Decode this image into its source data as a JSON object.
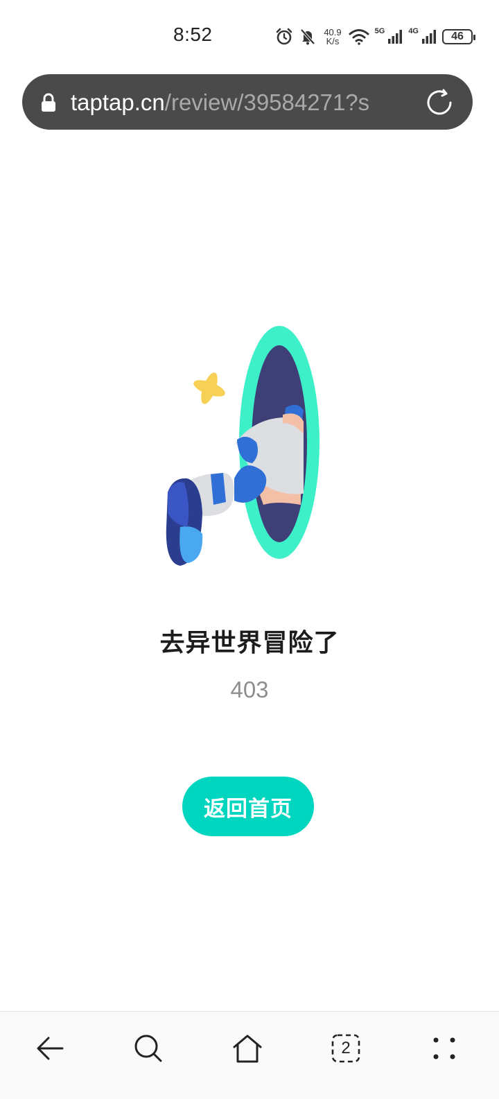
{
  "status_bar": {
    "time": "8:52",
    "net_speed_value": "40.9",
    "net_speed_unit": "K/s",
    "sim1_type": "5G",
    "sim2_type": "4G",
    "battery": "46"
  },
  "address_bar": {
    "domain": "taptap.cn",
    "path": "/review/39584271?s"
  },
  "error_page": {
    "title": "去异世界冒险了",
    "code": "403",
    "home_button_label": "返回首页"
  },
  "bottom_nav": {
    "tab_count": "2",
    "items": [
      "back-icon",
      "search-icon",
      "home-icon",
      "tabs-icon",
      "menu-icon"
    ]
  },
  "colors": {
    "accent": "#00d6bf",
    "portal_ring": "#3ef0c8",
    "portal_inner": "#3f3f78",
    "shoe_blue": "#2f6fd6"
  }
}
